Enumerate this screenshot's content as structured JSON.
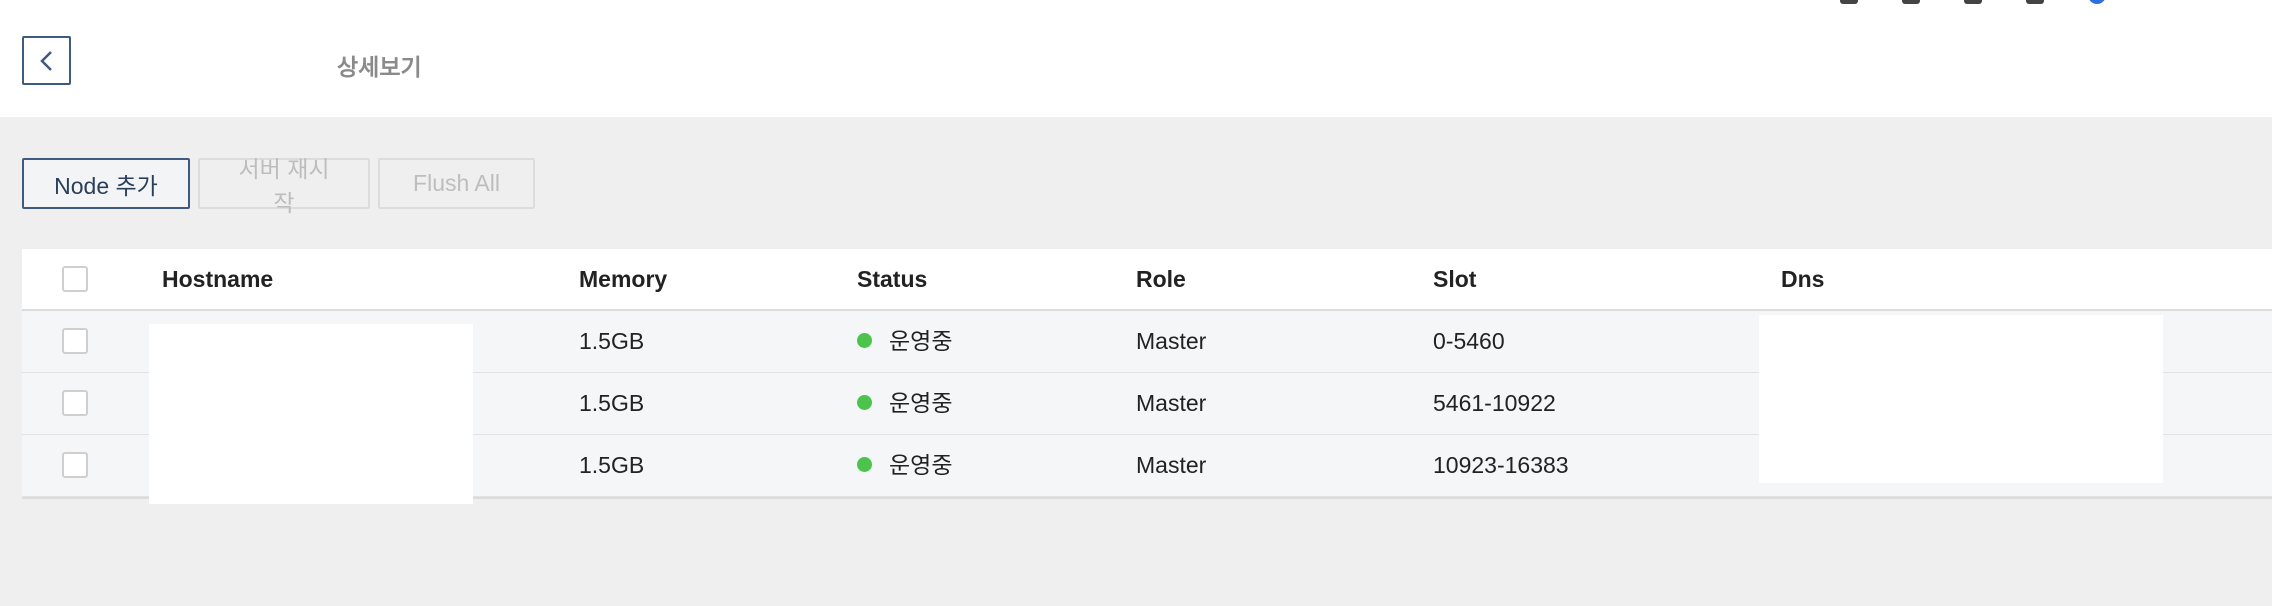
{
  "header": {
    "title": "상세보기",
    "back_icon": "chevron-left-icon"
  },
  "toolbar": {
    "add_node_label": "Node 추가",
    "restart_server_label": "서버 재시작",
    "flush_all_label": "Flush All"
  },
  "table": {
    "columns": [
      "Hostname",
      "Memory",
      "Status",
      "Role",
      "Slot",
      "Dns"
    ],
    "rows": [
      {
        "hostname": "",
        "memory": "1.5GB",
        "status": "운영중",
        "role": "Master",
        "slot": "0-5460",
        "dns": ""
      },
      {
        "hostname": "",
        "memory": "1.5GB",
        "status": "운영중",
        "role": "Master",
        "slot": "5461-10922",
        "dns": ""
      },
      {
        "hostname": "",
        "memory": "1.5GB",
        "status": "운영중",
        "role": "Master",
        "slot": "10923-16383",
        "dns": ""
      }
    ],
    "status_color": "#4cc34c"
  }
}
